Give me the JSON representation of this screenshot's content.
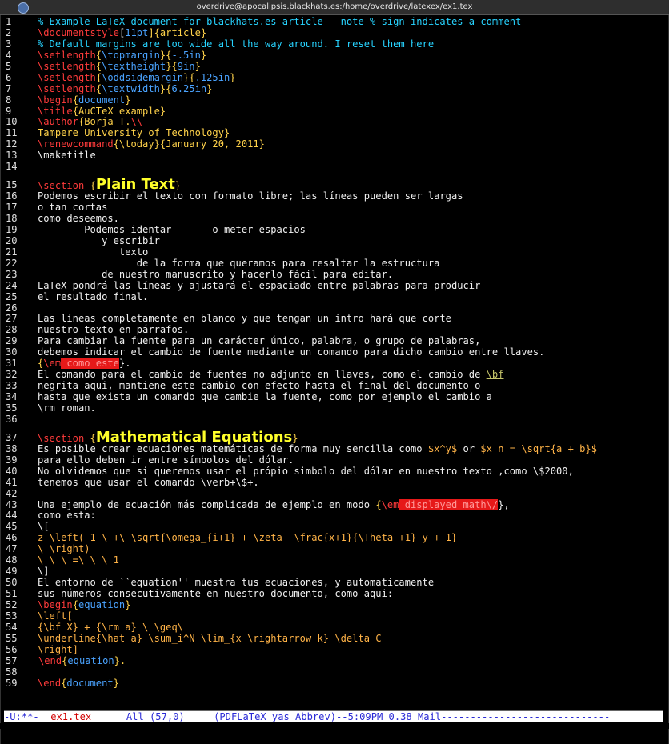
{
  "window": {
    "title": "overdrive@apocalipsis.blackhats.es:/home/overdrive/latexex/ex1.tex"
  },
  "lines": [
    {
      "n": "1",
      "tall": false,
      "segs": [
        {
          "t": "% Example LaTeX document for blackhats.es article - note % sign indicates a comment",
          "c": "comment"
        }
      ]
    },
    {
      "n": "2",
      "tall": false,
      "segs": [
        {
          "t": "\\documentstyle",
          "c": "kw"
        },
        {
          "t": "[",
          "c": "white"
        },
        {
          "t": "11pt",
          "c": "arg"
        },
        {
          "t": "]{article}",
          "c": "y"
        }
      ]
    },
    {
      "n": "3",
      "tall": false,
      "segs": [
        {
          "t": "% Default margins are too wide all the way around. I reset them here",
          "c": "comment"
        }
      ]
    },
    {
      "n": "4",
      "tall": false,
      "segs": [
        {
          "t": "\\setlength",
          "c": "kw"
        },
        {
          "t": "{",
          "c": "y"
        },
        {
          "t": "\\topmargin",
          "c": "arg"
        },
        {
          "t": "}{",
          "c": "y"
        },
        {
          "t": "-.5in",
          "c": "arg"
        },
        {
          "t": "}",
          "c": "y"
        }
      ]
    },
    {
      "n": "5",
      "tall": false,
      "segs": [
        {
          "t": "\\setlength",
          "c": "kw"
        },
        {
          "t": "{",
          "c": "y"
        },
        {
          "t": "\\textheight",
          "c": "arg"
        },
        {
          "t": "}{",
          "c": "y"
        },
        {
          "t": "9in",
          "c": "arg"
        },
        {
          "t": "}",
          "c": "y"
        }
      ]
    },
    {
      "n": "6",
      "tall": false,
      "segs": [
        {
          "t": "\\setlength",
          "c": "kw"
        },
        {
          "t": "{",
          "c": "y"
        },
        {
          "t": "\\oddsidemargin",
          "c": "arg"
        },
        {
          "t": "}{",
          "c": "y"
        },
        {
          "t": ".125in",
          "c": "arg"
        },
        {
          "t": "}",
          "c": "y"
        }
      ]
    },
    {
      "n": "7",
      "tall": false,
      "segs": [
        {
          "t": "\\setlength",
          "c": "kw"
        },
        {
          "t": "{",
          "c": "y"
        },
        {
          "t": "\\textwidth",
          "c": "arg"
        },
        {
          "t": "}{",
          "c": "y"
        },
        {
          "t": "6.25in",
          "c": "arg"
        },
        {
          "t": "}",
          "c": "y"
        }
      ]
    },
    {
      "n": "8",
      "tall": false,
      "segs": [
        {
          "t": "\\begin",
          "c": "kw"
        },
        {
          "t": "{",
          "c": "y"
        },
        {
          "t": "document",
          "c": "arg"
        },
        {
          "t": "}",
          "c": "y"
        }
      ]
    },
    {
      "n": "9",
      "tall": false,
      "segs": [
        {
          "t": "\\title",
          "c": "kw"
        },
        {
          "t": "{AuCTeX example}",
          "c": "y"
        }
      ]
    },
    {
      "n": "10",
      "tall": false,
      "segs": [
        {
          "t": "\\author",
          "c": "kw"
        },
        {
          "t": "{Borja T.",
          "c": "y"
        },
        {
          "t": "\\\\",
          "c": "kw"
        }
      ]
    },
    {
      "n": "11",
      "tall": false,
      "segs": [
        {
          "t": "Tampere University of Technology}",
          "c": "y"
        }
      ]
    },
    {
      "n": "12",
      "tall": false,
      "segs": [
        {
          "t": "\\renewcommand",
          "c": "kw"
        },
        {
          "t": "{\\today}{January 20, 2011}",
          "c": "y"
        }
      ]
    },
    {
      "n": "13",
      "tall": false,
      "segs": [
        {
          "t": "\\maketitle",
          "c": "white"
        }
      ]
    },
    {
      "n": "14",
      "tall": false,
      "segs": []
    },
    {
      "n": "15",
      "tall": true,
      "segs": [
        {
          "t": "\\section ",
          "c": "kw"
        },
        {
          "t": "{",
          "c": "y"
        },
        {
          "t": "Plain Text",
          "c": "yb"
        },
        {
          "t": "}",
          "c": "y"
        }
      ]
    },
    {
      "n": "16",
      "tall": false,
      "segs": [
        {
          "t": "Podemos escribir el texto con formato libre; las líneas pueden ser largas",
          "c": "white"
        }
      ]
    },
    {
      "n": "17",
      "tall": false,
      "segs": [
        {
          "t": "o tan cortas",
          "c": "white"
        }
      ]
    },
    {
      "n": "18",
      "tall": false,
      "segs": [
        {
          "t": "como deseemos.",
          "c": "white"
        }
      ]
    },
    {
      "n": "19",
      "tall": false,
      "segs": [
        {
          "t": "        Podemos identar       o meter espacios",
          "c": "white"
        }
      ]
    },
    {
      "n": "20",
      "tall": false,
      "segs": [
        {
          "t": "           y escribir",
          "c": "white"
        }
      ]
    },
    {
      "n": "21",
      "tall": false,
      "segs": [
        {
          "t": "              texto",
          "c": "white"
        }
      ]
    },
    {
      "n": "22",
      "tall": false,
      "segs": [
        {
          "t": "                 de la forma que queramos para resaltar la estructura",
          "c": "white"
        }
      ]
    },
    {
      "n": "23",
      "tall": false,
      "segs": [
        {
          "t": "           de nuestro manuscrito y hacerlo fácil para editar.",
          "c": "white"
        }
      ]
    },
    {
      "n": "24",
      "tall": false,
      "segs": [
        {
          "t": "LaTeX pondrá las líneas y ajustará el espaciado entre palabras para producir",
          "c": "white"
        }
      ]
    },
    {
      "n": "25",
      "tall": false,
      "segs": [
        {
          "t": "el resultado final.",
          "c": "white"
        }
      ]
    },
    {
      "n": "26",
      "tall": false,
      "segs": []
    },
    {
      "n": "27",
      "tall": false,
      "segs": [
        {
          "t": "Las líneas completamente en blanco y que tengan un intro hará que corte",
          "c": "white"
        }
      ]
    },
    {
      "n": "28",
      "tall": false,
      "segs": [
        {
          "t": "nuestro texto en párrafos.",
          "c": "white"
        }
      ]
    },
    {
      "n": "29",
      "tall": false,
      "segs": [
        {
          "t": "Para cambiar la fuente para un carácter único, palabra, o grupo de palabras,",
          "c": "white"
        }
      ]
    },
    {
      "n": "30",
      "tall": false,
      "segs": [
        {
          "t": "debemos indicar el cambio de fuente mediante un comando para dicho cambio entre llaves.",
          "c": "white"
        }
      ]
    },
    {
      "n": "31",
      "tall": false,
      "segs": [
        {
          "t": "{",
          "c": "y"
        },
        {
          "t": "\\em",
          "c": "kw"
        },
        {
          "t": " como este",
          "c": "hl"
        },
        {
          "t": "}.",
          "c": "white"
        }
      ]
    },
    {
      "n": "32",
      "tall": false,
      "segs": [
        {
          "t": "El comando para el cambio de fuentes no adjunto en llaves, como el cambio de ",
          "c": "white"
        },
        {
          "t": "\\bf",
          "c": "bf"
        }
      ]
    },
    {
      "n": "33",
      "tall": false,
      "segs": [
        {
          "t": "negrita aqui, mantiene este cambio con efecto hasta el final del documento o",
          "c": "white"
        }
      ]
    },
    {
      "n": "34",
      "tall": false,
      "segs": [
        {
          "t": "hasta que exista un comando que cambie la fuente, como por ejemplo el cambio a",
          "c": "white"
        }
      ]
    },
    {
      "n": "35",
      "tall": false,
      "segs": [
        {
          "t": "\\rm roman.",
          "c": "white"
        }
      ]
    },
    {
      "n": "36",
      "tall": false,
      "segs": []
    },
    {
      "n": "37",
      "tall": true,
      "segs": [
        {
          "t": "\\section ",
          "c": "kw"
        },
        {
          "t": "{",
          "c": "y"
        },
        {
          "t": "Mathematical Equations",
          "c": "yb"
        },
        {
          "t": "}",
          "c": "y"
        }
      ]
    },
    {
      "n": "38",
      "tall": false,
      "segs": [
        {
          "t": "Es posible crear ecuaciones matemáticas de forma muy sencilla como ",
          "c": "white"
        },
        {
          "t": "$x^y$",
          "c": "or"
        },
        {
          "t": " or ",
          "c": "white"
        },
        {
          "t": "$x_n = \\sqrt{a + b}$",
          "c": "or"
        }
      ]
    },
    {
      "n": "39",
      "tall": false,
      "segs": [
        {
          "t": "para ello deben ir entre símbolos del dólar.",
          "c": "white"
        }
      ]
    },
    {
      "n": "40",
      "tall": false,
      "segs": [
        {
          "t": "No olvidemos que si queremos usar el própio simbolo del dólar en nuestro texto ,como \\$2000,",
          "c": "white"
        }
      ]
    },
    {
      "n": "41",
      "tall": false,
      "segs": [
        {
          "t": "tenemos que usar el comando \\verb+\\$+.",
          "c": "white"
        }
      ]
    },
    {
      "n": "42",
      "tall": false,
      "segs": []
    },
    {
      "n": "43",
      "tall": false,
      "segs": [
        {
          "t": "Una ejemplo de ecuación más complicada de ejemplo en modo ",
          "c": "white"
        },
        {
          "t": "{",
          "c": "y"
        },
        {
          "t": "\\em",
          "c": "kw"
        },
        {
          "t": " displayed math\\/",
          "c": "hl"
        },
        {
          "t": "},",
          "c": "white"
        }
      ]
    },
    {
      "n": "44",
      "tall": false,
      "segs": [
        {
          "t": "como esta:",
          "c": "white"
        }
      ]
    },
    {
      "n": "45",
      "tall": false,
      "segs": [
        {
          "t": "\\[",
          "c": "white"
        }
      ]
    },
    {
      "n": "46",
      "tall": false,
      "segs": [
        {
          "t": "z \\left( 1 \\ +\\ \\sqrt{\\omega_{i+1} + \\zeta -\\frac{x+1}{\\Theta +1} y + 1}",
          "c": "or"
        }
      ]
    },
    {
      "n": "47",
      "tall": false,
      "segs": [
        {
          "t": "\\ \\right)",
          "c": "or"
        }
      ]
    },
    {
      "n": "48",
      "tall": false,
      "segs": [
        {
          "t": "\\ \\ \\ =\\ \\ \\ 1",
          "c": "or"
        }
      ]
    },
    {
      "n": "49",
      "tall": false,
      "segs": [
        {
          "t": "\\]",
          "c": "white"
        }
      ]
    },
    {
      "n": "50",
      "tall": false,
      "segs": [
        {
          "t": "El entorno de ``equation'' muestra tus ecuaciones, y automaticamente",
          "c": "white"
        }
      ]
    },
    {
      "n": "51",
      "tall": false,
      "segs": [
        {
          "t": "sus números consecutivamente en nuestro documento, como aqui:",
          "c": "white"
        }
      ]
    },
    {
      "n": "52",
      "tall": false,
      "segs": [
        {
          "t": "\\begin",
          "c": "kw"
        },
        {
          "t": "{",
          "c": "y"
        },
        {
          "t": "equation",
          "c": "arg"
        },
        {
          "t": "}",
          "c": "y"
        }
      ]
    },
    {
      "n": "53",
      "tall": false,
      "segs": [
        {
          "t": "\\left[",
          "c": "or"
        }
      ]
    },
    {
      "n": "54",
      "tall": false,
      "segs": [
        {
          "t": "{\\bf X} + {\\rm a} \\ \\geq\\",
          "c": "or"
        }
      ]
    },
    {
      "n": "55",
      "tall": false,
      "segs": [
        {
          "t": "\\underline{\\hat a} \\sum_i^N \\lim_{x \\rightarrow k} \\delta C",
          "c": "or"
        }
      ]
    },
    {
      "n": "56",
      "tall": false,
      "segs": [
        {
          "t": "\\right]",
          "c": "or"
        }
      ]
    },
    {
      "n": "57",
      "tall": false,
      "cursor": true,
      "segs": [
        {
          "t": "\\end",
          "c": "kw"
        },
        {
          "t": "{",
          "c": "y"
        },
        {
          "t": "equation",
          "c": "arg"
        },
        {
          "t": "}.",
          "c": "y"
        }
      ]
    },
    {
      "n": "58",
      "tall": false,
      "segs": []
    },
    {
      "n": "59",
      "tall": false,
      "segs": [
        {
          "t": "\\end",
          "c": "kw"
        },
        {
          "t": "{",
          "c": "y"
        },
        {
          "t": "document",
          "c": "arg"
        },
        {
          "t": "}",
          "c": "y"
        }
      ]
    }
  ],
  "modeline": {
    "status": "-U:**-  ",
    "buffer": "ex1.tex",
    "position": "      All (57,0)     ",
    "modes": "(PDFLaTeX yas Abbrev)--5:09PM 0.38 Mail-----------------------------"
  },
  "icons": {
    "window_icon": "terminal-app-icon"
  }
}
